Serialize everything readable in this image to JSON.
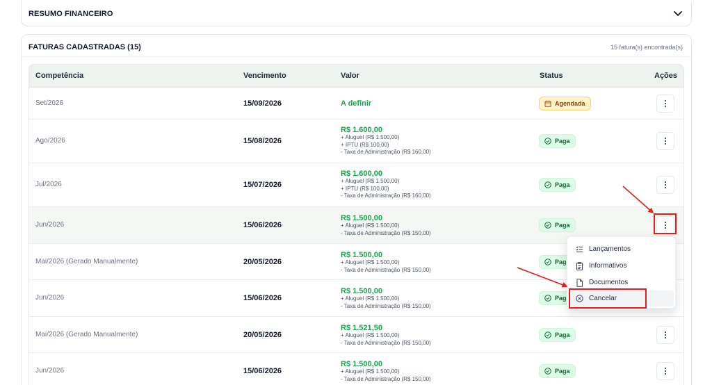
{
  "summary": {
    "title": "RESUMO FINANCEIRO"
  },
  "invoices": {
    "title": "FATURAS CADASTRADAS (15)",
    "count_text": "15 fatura(s) encontrada(s)",
    "columns": {
      "competencia": "Competência",
      "vencimento": "Vencimento",
      "valor": "Valor",
      "status": "Status",
      "acoes": "Ações"
    },
    "rows": [
      {
        "competencia": "Set/2026",
        "vencimento": "15/09/2026",
        "valor": "A definir",
        "details": [],
        "status": "Agendada"
      },
      {
        "competencia": "Ago/2026",
        "vencimento": "15/08/2026",
        "valor": "R$ 1.600,00",
        "details": [
          "+ Aluguel (R$ 1.500,00)",
          "+ IPTU (R$ 100,00)",
          "- Taxa de Administração (R$ 160,00)"
        ],
        "status": "Paga"
      },
      {
        "competencia": "Jul/2026",
        "vencimento": "15/07/2026",
        "valor": "R$ 1.600,00",
        "details": [
          "+ Aluguel (R$ 1.500,00)",
          "+ IPTU (R$ 100,00)",
          "- Taxa de Administração (R$ 160,00)"
        ],
        "status": "Paga"
      },
      {
        "competencia": "Jun/2026",
        "vencimento": "15/06/2026",
        "valor": "R$ 1.500,00",
        "details": [
          "+ Aluguel (R$ 1.500,00)",
          "- Taxa de Administração (R$ 150,00)"
        ],
        "status": "Paga"
      },
      {
        "competencia": "Mai/2026 (Gerado Manualmente)",
        "vencimento": "20/05/2026",
        "valor": "R$ 1.500,00",
        "details": [
          "+ Aluguel (R$ 1.500,00)",
          "- Taxa de Administração (R$ 150,00)"
        ],
        "status": "Paga"
      },
      {
        "competencia": "Jun/2026",
        "vencimento": "15/06/2026",
        "valor": "R$ 1.500,00",
        "details": [
          "+ Aluguel (R$ 1.500,00)",
          "- Taxa de Administração (R$ 150,00)"
        ],
        "status": "Paga"
      },
      {
        "competencia": "Mai/2026 (Gerado Manualmente)",
        "vencimento": "20/05/2026",
        "valor": "R$ 1.521,50",
        "details": [
          "+ Aluguel (R$ 1.500,00)",
          "- Taxa de Administração (R$ 150,00)"
        ],
        "status": "Paga"
      },
      {
        "competencia": "Jun/2026",
        "vencimento": "15/06/2026",
        "valor": "R$ 1.500,00",
        "details": [
          "+ Aluguel (R$ 1.500,00)",
          "- Taxa de Administração (R$ 150,00)"
        ],
        "status": "Paga"
      }
    ]
  },
  "actions_menu": {
    "items": [
      {
        "label": "Lançamentos",
        "icon": "list-check-icon"
      },
      {
        "label": "Informativos",
        "icon": "clipboard-icon"
      },
      {
        "label": "Documentos",
        "icon": "document-icon"
      },
      {
        "label": "Cancelar",
        "icon": "cancel-circle-icon"
      }
    ]
  },
  "colors": {
    "accent_green": "#16a34a",
    "annotation_red": "#e11d1d",
    "agendada_bg": "#fef3c7",
    "paga_bg": "#dcfce7"
  }
}
